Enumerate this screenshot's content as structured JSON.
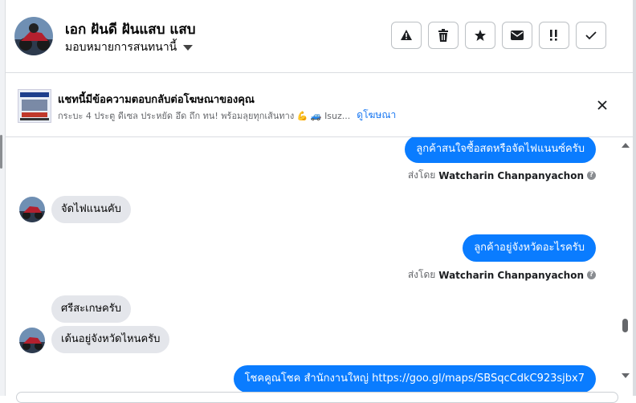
{
  "header": {
    "contact_name": "เอก ฝันดี ฝันแสบ แสบ",
    "assign_label": "มอบหมายการสนทนานี้",
    "actions": [
      {
        "icon": "warning-icon",
        "label": "Report"
      },
      {
        "icon": "trash-icon",
        "label": "Delete"
      },
      {
        "icon": "star-icon",
        "label": "Star"
      },
      {
        "icon": "envelope-icon",
        "label": "Mark as unread"
      },
      {
        "icon": "follow-up-icon",
        "label": "Follow up"
      },
      {
        "icon": "check-icon",
        "label": "Mark as done"
      }
    ]
  },
  "ad_banner": {
    "title": "แชทนี้มีข้อความตอบกลับต่อโฆษณาของคุณ",
    "subtitle": "กระบะ 4 ประตู ดีเซล ประหยัด อึด ถึก ทน! พร้อมลุยทุกเส้นทาง 💪 🚙 Isuz...",
    "view_ad_link": "ดูโฆษณา"
  },
  "messages": [
    {
      "direction": "out",
      "text": "ลูกค้าสนใจซื้อสดหรือจัดไฟแนนซ์ครับ"
    },
    {
      "type": "sent_by",
      "prefix": "ส่งโดย",
      "name": "Watcharin Chanpanyachon"
    },
    {
      "direction": "in",
      "text": "จัดไฟแนนคับ"
    },
    {
      "direction": "out",
      "text": "ลูกค้าอยู่จังหวัดอะไรครับ"
    },
    {
      "type": "sent_by",
      "prefix": "ส่งโดย",
      "name": "Watcharin Chanpanyachon"
    },
    {
      "direction": "in",
      "text": "ศรีสะเกษครับ"
    },
    {
      "direction": "in",
      "text": "เด้นอยู่จังหวัดไหนครับ"
    },
    {
      "direction": "out",
      "text": "โชคคูณโชค สำนักงานใหญ่ https://goo.gl/maps/SBSqcCdkC923sjbx7"
    }
  ],
  "colors": {
    "outgoing_bubble": "#0a7cff",
    "incoming_bubble": "#e4e6eb",
    "link": "#1877f2",
    "muted_text": "#65676b"
  }
}
